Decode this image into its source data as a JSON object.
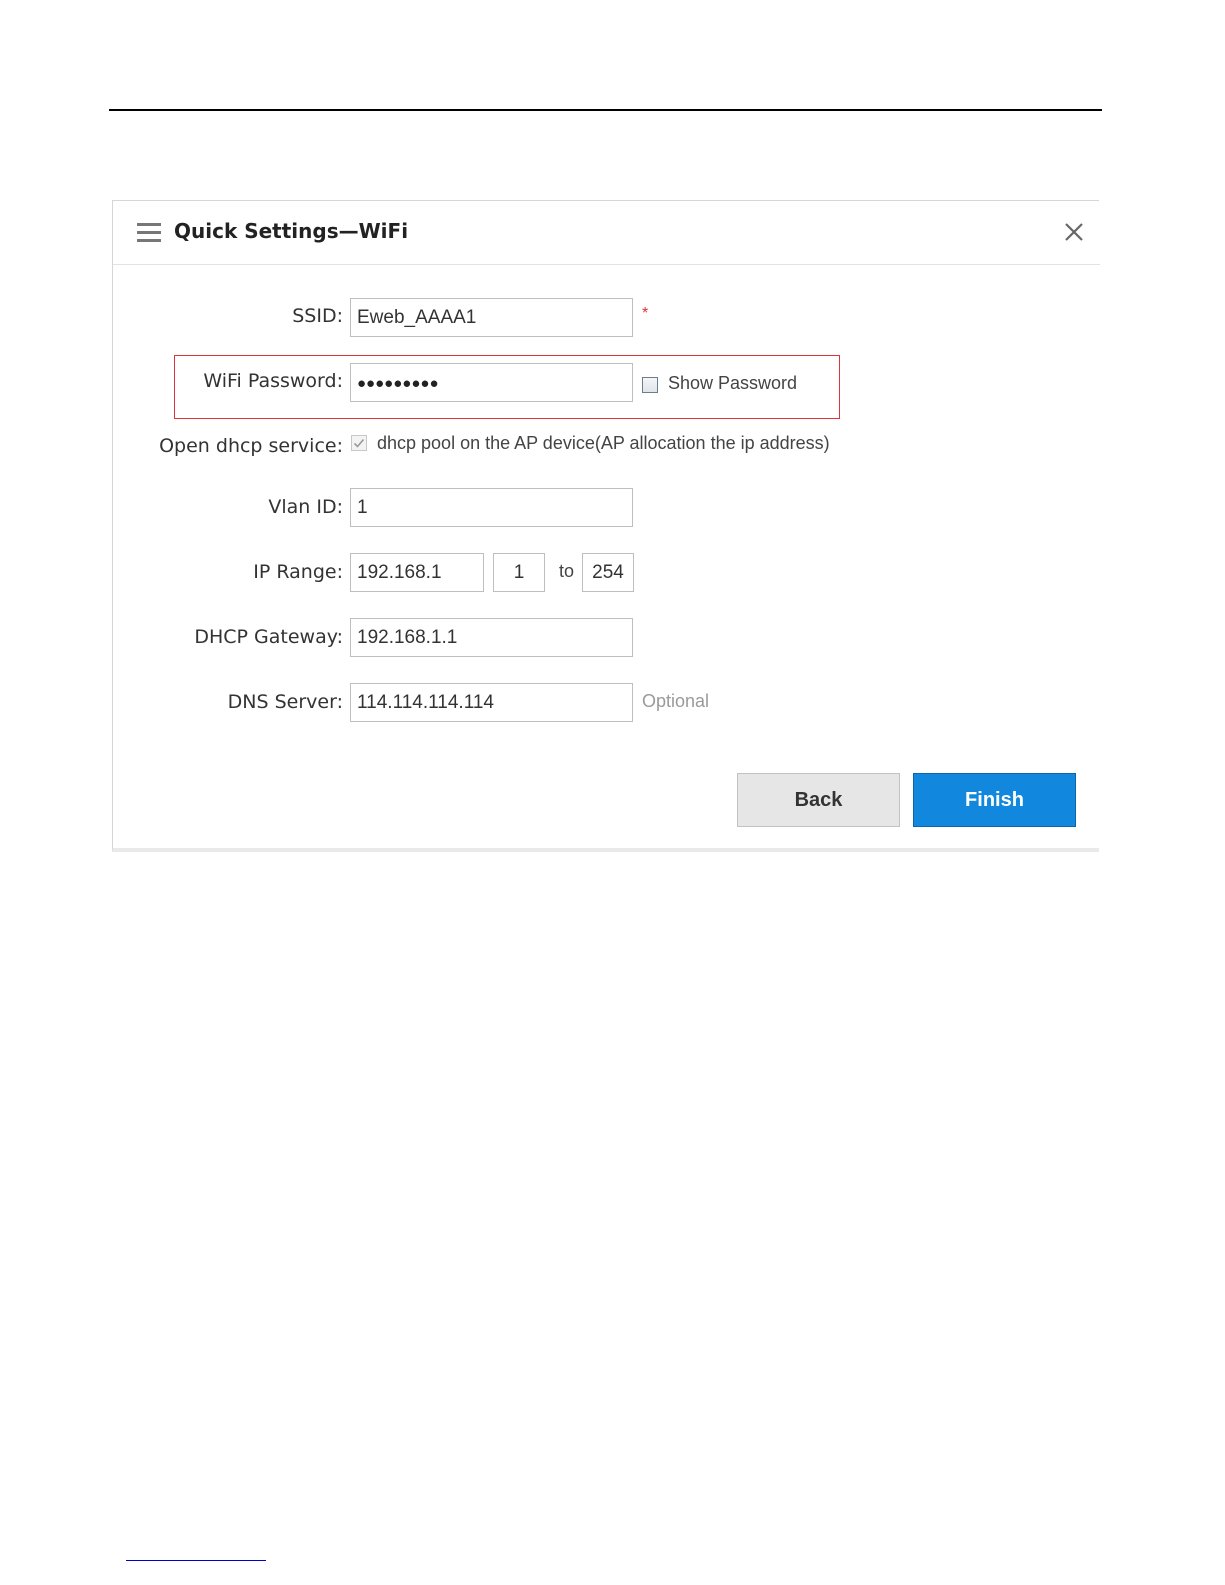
{
  "dialog": {
    "title": "Quick Settings—WiFi",
    "menu_icon": "menu-icon",
    "close_icon": "close-icon"
  },
  "form": {
    "ssid": {
      "label": "SSID:",
      "value": "Eweb_AAAA1",
      "required_mark": "*"
    },
    "wifi_password": {
      "label": "WiFi Password:",
      "masked_value": "●●●●●●●●●",
      "show_password_label": "Show Password",
      "show_password_checked": false
    },
    "dhcp": {
      "label": "Open dhcp service:",
      "checkbox_label": "dhcp pool on the AP device(AP allocation the ip address)",
      "checked": true,
      "disabled": true
    },
    "vlan": {
      "label": "Vlan ID:",
      "value": "1"
    },
    "ip_range": {
      "label": "IP Range:",
      "prefix": "192.168.1",
      "start": "1",
      "separator": "to",
      "end": "254"
    },
    "dhcp_gateway": {
      "label": "DHCP Gateway:",
      "value": "192.168.1.1"
    },
    "dns_server": {
      "label": "DNS Server:",
      "value": "114.114.114.114",
      "hint": "Optional"
    }
  },
  "buttons": {
    "back_label": "Back",
    "finish_label": "Finish"
  },
  "colors": {
    "finish_button": "#1188dd",
    "highlight_border": "#e0323a",
    "required_star": "#e03030"
  }
}
